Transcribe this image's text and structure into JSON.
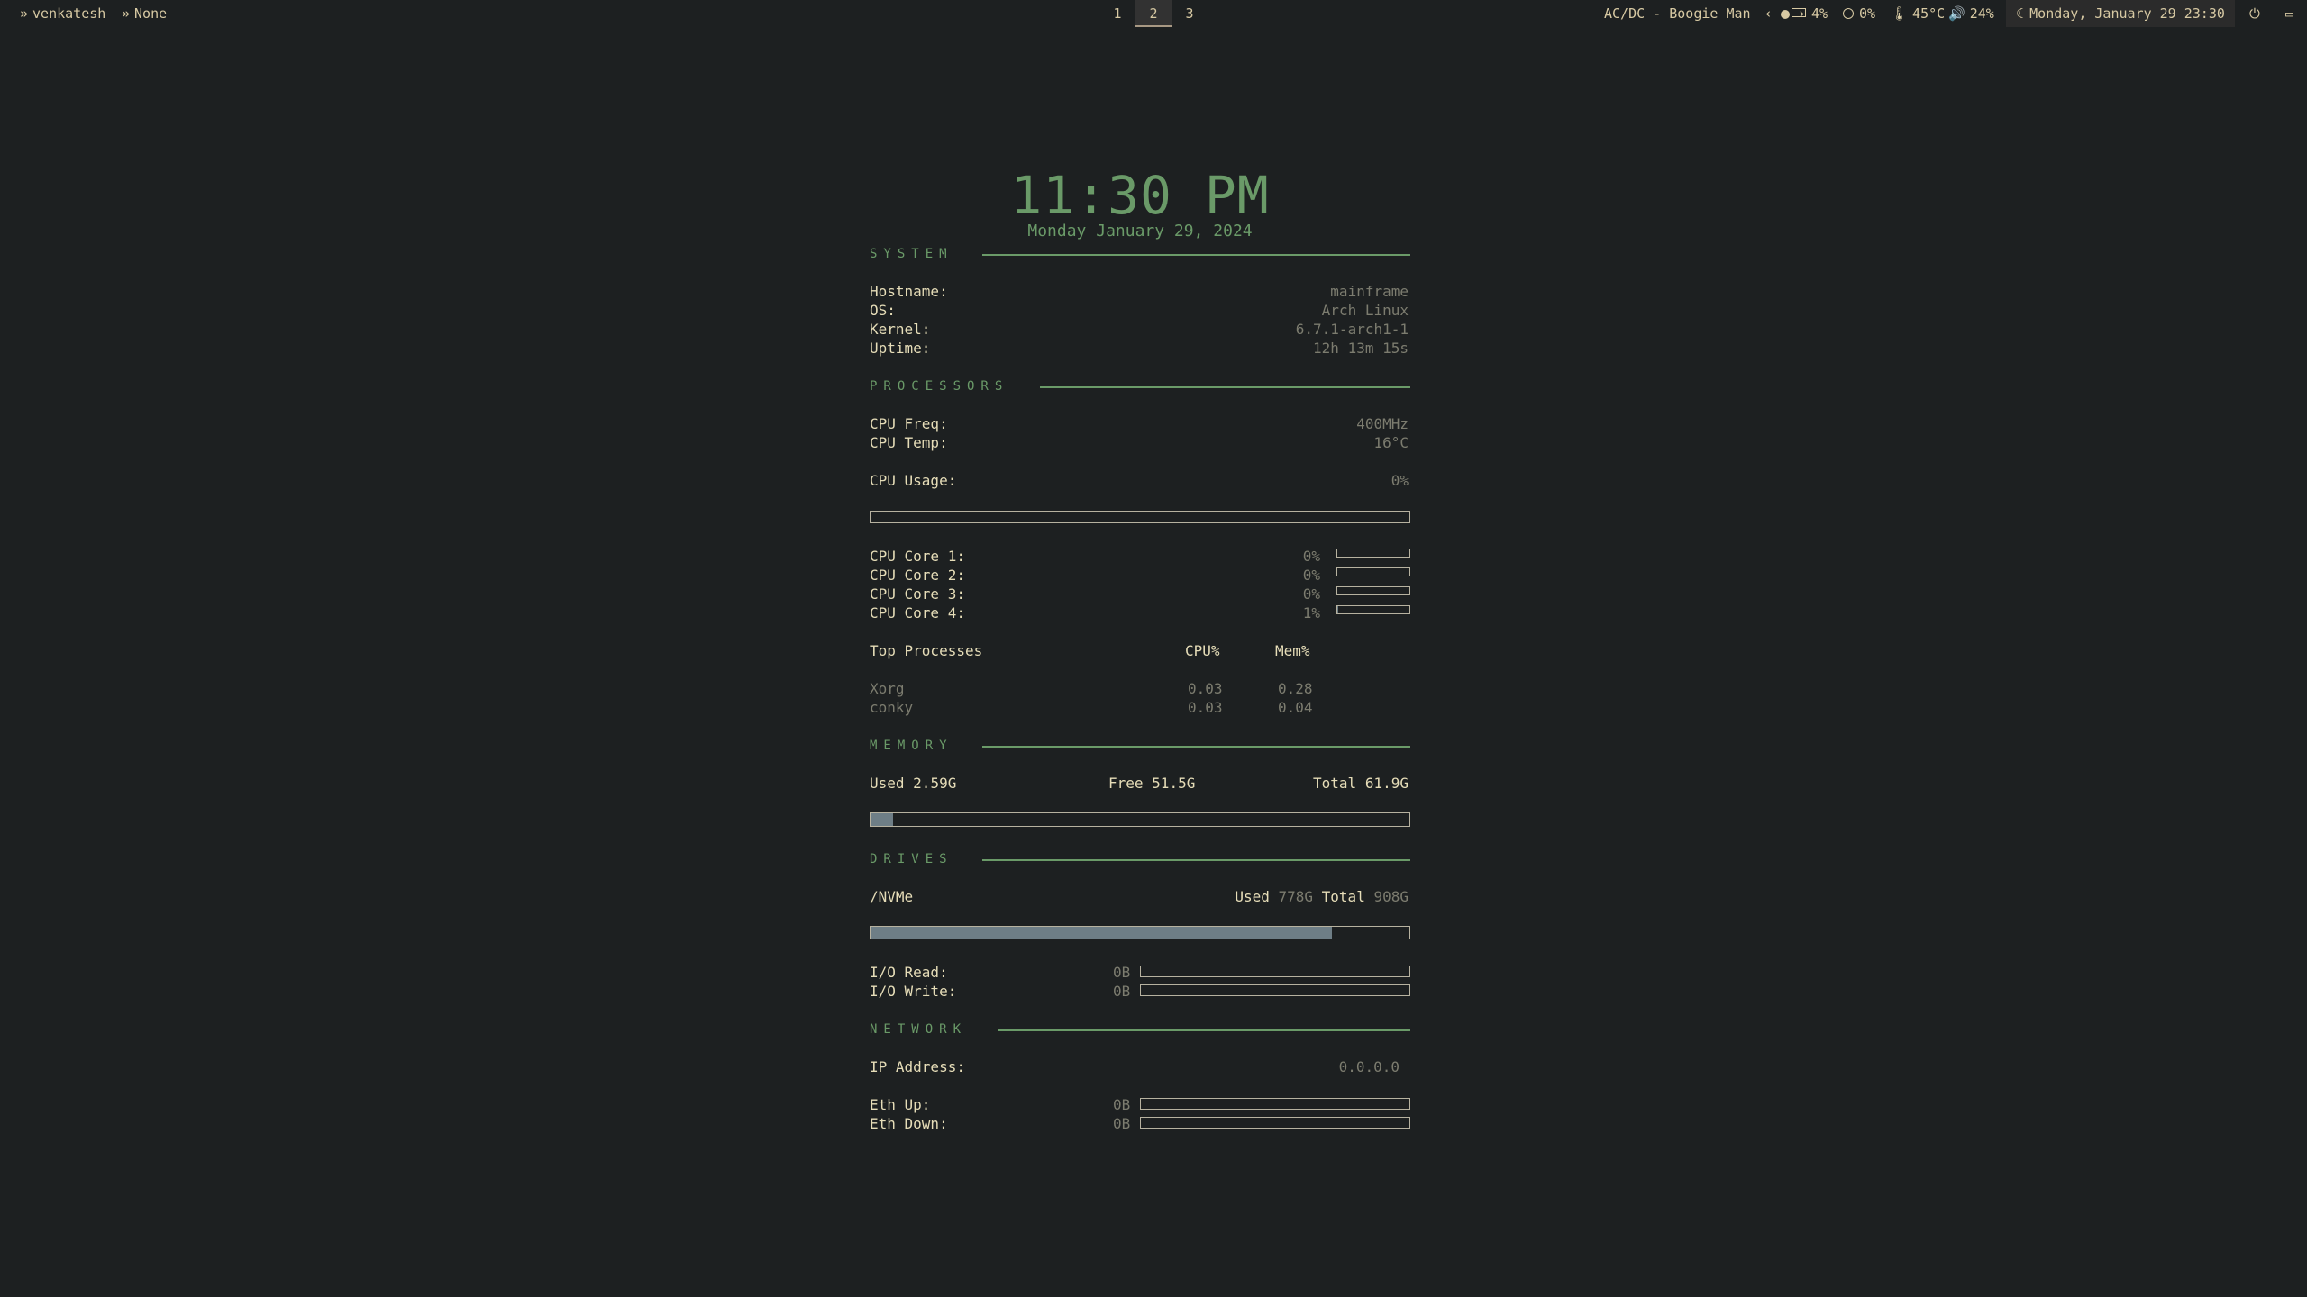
{
  "topbar": {
    "user": "venkatesh",
    "window": "None",
    "workspaces": [
      "1",
      "2",
      "3"
    ],
    "active_workspace": "2",
    "music": "AC/DC - Boogie Man",
    "cpu": "4%",
    "mem": "0%",
    "temp": "45°C",
    "volume": "24%",
    "datetime": "Monday, January 29 23:30"
  },
  "clock": {
    "time": "11:30 PM",
    "date": "Monday January 29, 2024"
  },
  "system": {
    "title": "SYSTEM",
    "rows": [
      {
        "label": "Hostname:",
        "value": "mainframe"
      },
      {
        "label": "OS:",
        "value": "Arch Linux"
      },
      {
        "label": "Kernel:",
        "value": "6.7.1-arch1-1"
      },
      {
        "label": "Uptime:",
        "value": "12h 13m 15s"
      }
    ]
  },
  "processors": {
    "title": "PROCESSORS",
    "freq_label": "CPU Freq:",
    "freq": "400MHz",
    "temp_label": "CPU Temp:",
    "temp": "16°C",
    "usage_label": "CPU Usage:",
    "usage": "0%",
    "usage_fraction": 0,
    "cores": [
      {
        "label": "CPU Core 1:",
        "value": "0%",
        "fraction": 0
      },
      {
        "label": "CPU Core 2:",
        "value": "0%",
        "fraction": 0
      },
      {
        "label": "CPU Core 3:",
        "value": "0%",
        "fraction": 0
      },
      {
        "label": "CPU Core 4:",
        "value": "1%",
        "fraction": 0.01
      }
    ],
    "top": {
      "header": "Top Processes",
      "cpu_header": "CPU%",
      "mem_header": "Mem%",
      "rows": [
        {
          "name": "Xorg",
          "cpu": "0.03",
          "mem": "0.28"
        },
        {
          "name": "conky",
          "cpu": "0.03",
          "mem": "0.04"
        }
      ]
    }
  },
  "memory": {
    "title": "MEMORY",
    "used_label": "Used",
    "used": "2.59G",
    "free_label": "Free",
    "free": "51.5G",
    "total_label": "Total",
    "total": "61.9G",
    "used_fraction": 0.042
  },
  "drives": {
    "title": "DRIVES",
    "name": "/NVMe",
    "used_label": "Used",
    "used": "778G",
    "total_label": "Total",
    "total": "908G",
    "used_fraction": 0.857,
    "io_read_label": "I/O Read:",
    "io_read": "0B",
    "io_write_label": "I/O Write:",
    "io_write": "0B"
  },
  "network": {
    "title": "NETWORK",
    "ip_label": "IP Address:",
    "ip": "0.0.0.0",
    "up_label": "Eth Up:",
    "up": "0B",
    "down_label": "Eth Down:",
    "down": "0B"
  },
  "colors": {
    "background": "#1d2021",
    "accent": "#6a9a68",
    "bar_fill": "#6e7e86"
  }
}
